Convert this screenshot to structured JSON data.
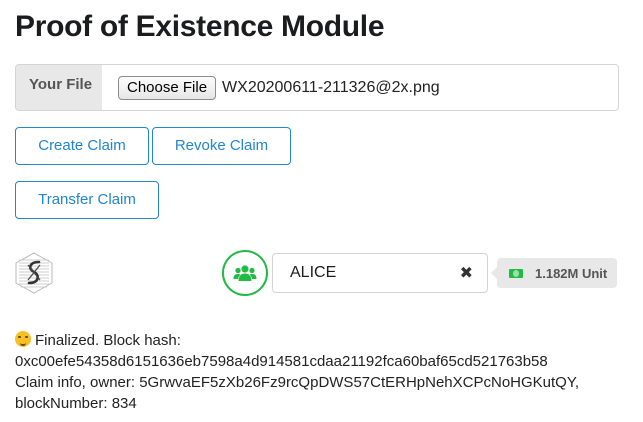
{
  "page": {
    "title": "Proof of Existence Module"
  },
  "file": {
    "label": "Your File",
    "choose_button": "Choose File",
    "file_name": "WX20200611-211326@2x.png"
  },
  "actions": {
    "create": "Create Claim",
    "revoke": "Revoke Claim",
    "transfer": "Transfer Claim"
  },
  "account": {
    "icon": "users-icon",
    "name": "ALICE",
    "clear_icon": "close-icon",
    "balance_icon": "money-icon",
    "balance": "1.182M Unit",
    "accent_color": "#21ba45"
  },
  "status": {
    "line1": "Finalized. Block hash:",
    "line2": "0xc00efe54358d6151636eb7598a4d914581cdaa21192fca60baf65cd521763b58",
    "line3": "Claim info, owner: 5GrwvaEF5zXb26Fz9rcQpDWS57CtERHpNehXCPcNoHGKutQY,",
    "line4": "blockNumber: 834"
  },
  "colors": {
    "primary": "#2185d0",
    "positive": "#21ba45"
  }
}
